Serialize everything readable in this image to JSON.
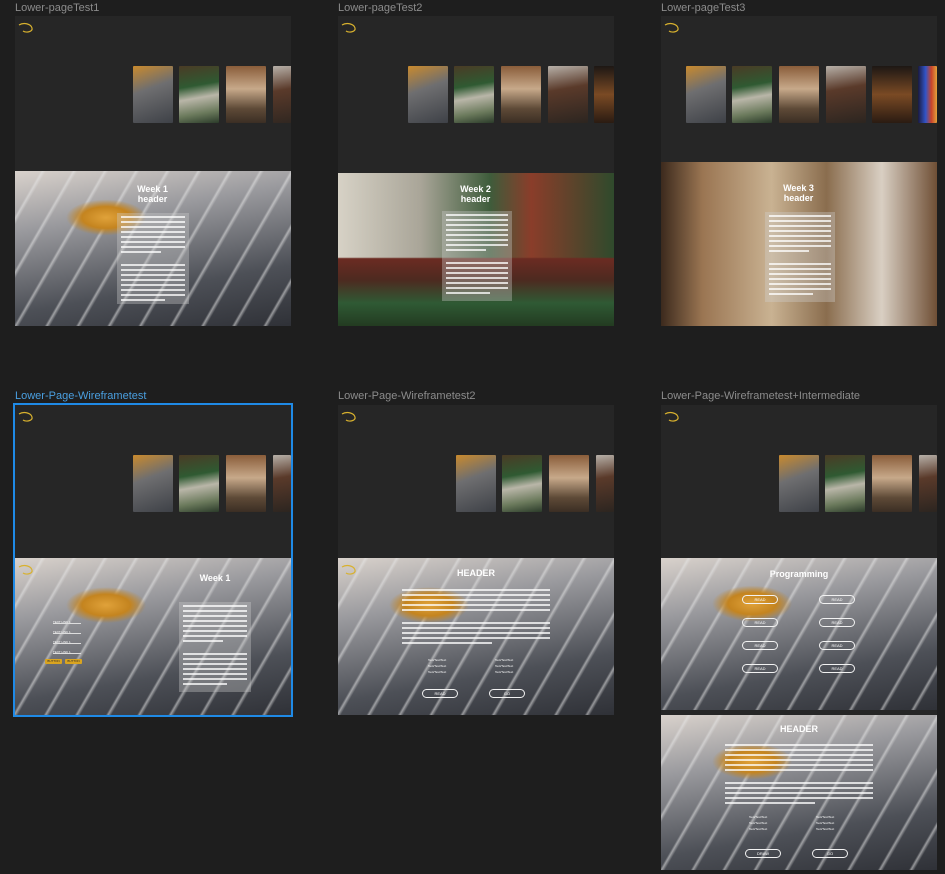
{
  "frames": [
    {
      "label": "Lower-pageTest1"
    },
    {
      "label": "Lower-pageTest2"
    },
    {
      "label": "Lower-pageTest3"
    },
    {
      "label": "Lower-Page-Wireframetest"
    },
    {
      "label": "Lower-Page-Wireframetest2"
    },
    {
      "label": "Lower-Page-Wireframetest+Intermediate"
    }
  ],
  "heroes": {
    "week1_header": "Week 1\nheader",
    "week2_header": "Week 2\nheader",
    "week3_header": "Week 3\nheader",
    "week1": "Week 1",
    "header": "HEADER",
    "programming": "Programming",
    "header2": "HEADER"
  },
  "wireframe": {
    "links": [
      "TEXT LINK 1",
      "TEXT LINK 1",
      "TEXT LINK 1",
      "TEXT LINK 1"
    ],
    "buttons": [
      "BUTTON",
      "BUTTON"
    ]
  },
  "wireframe2": {
    "bullets": [
      "Text/Text/Text",
      "Text/Text/Text",
      "Text/Text/Text",
      "Text/Text/Text",
      "Text/Text/Text",
      "Text/Text/Text"
    ],
    "pills": [
      "READ",
      "GO"
    ]
  },
  "programming": {
    "pills": [
      "READ",
      "READ",
      "READ",
      "READ",
      "READ",
      "READ",
      "READ",
      "READ"
    ]
  },
  "intermediate": {
    "bullets": [
      "Text/Text/Text",
      "Text/Text/Text",
      "Text/Text/Text",
      "Text/Text/Text",
      "Text/Text/Text",
      "Text/Text/Text"
    ],
    "pills": [
      "DRAW",
      "GO"
    ]
  },
  "colors": {
    "canvas": "#1e1e1e",
    "frame": "#262626",
    "selection": "#1f8ae6",
    "label": "#8c8c8c",
    "accent_yellow": "#d9a420"
  },
  "icons": {
    "logo": "swirl-logo-icon"
  }
}
